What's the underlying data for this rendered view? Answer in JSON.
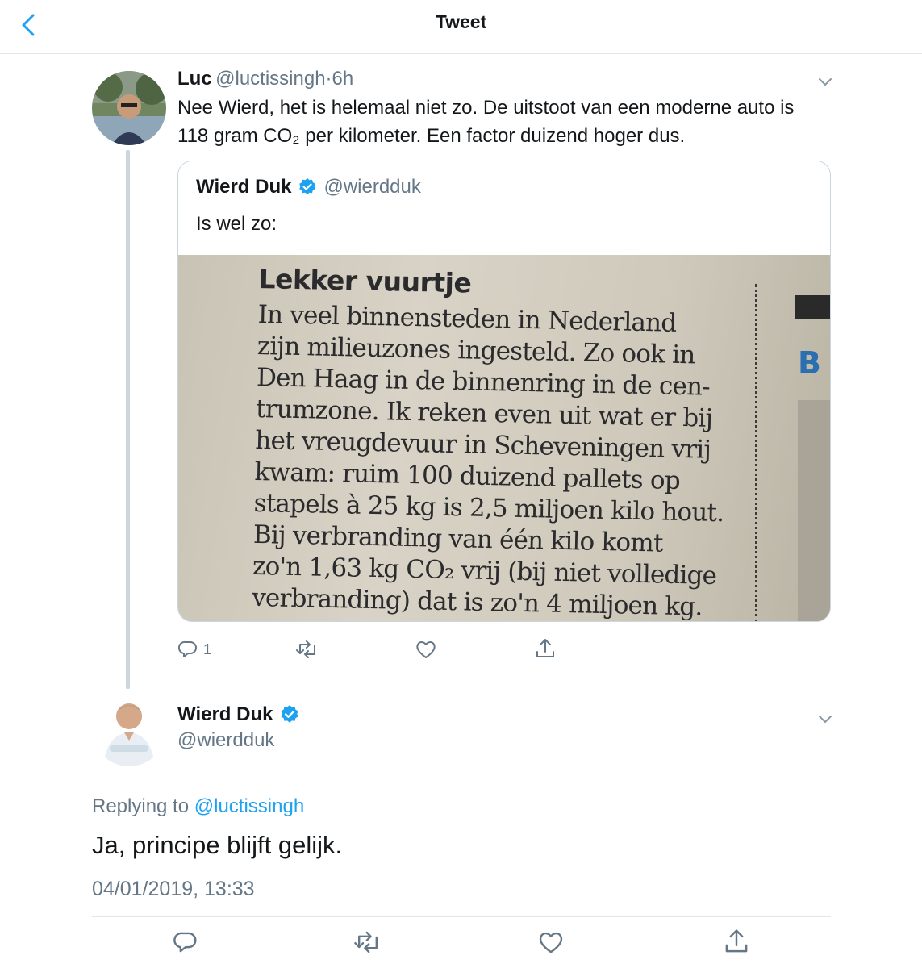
{
  "header": {
    "title": "Tweet",
    "back_icon": "chevron-left-icon"
  },
  "reply_tweet": {
    "author_name": "Luc",
    "author_handle": "@luctissingh",
    "separator": "·",
    "time": "6h",
    "text_line1": "Nee Wierd, het is helemaal niet zo. De uitstoot van een moderne auto is",
    "text_line2": "118 gram CO₂ per kilometer. Een factor duizend hoger dus.",
    "actions": {
      "reply_count": "1"
    }
  },
  "quoted_tweet": {
    "author_name": "Wierd Duk",
    "author_handle": "@wierdduk",
    "text": "Is wel zo:",
    "image": {
      "heading": "Lekker vuurtje",
      "lines": [
        "In veel binnensteden in Nederland",
        "zijn milieuzones ingesteld. Zo ook in",
        "Den Haag in de binnenring in de cen-",
        "trumzone. Ik reken even uit wat er bij",
        "het vreugdevuur in Scheveningen vrij",
        "kwam: ruim 100 duizend pallets op",
        "stapels à 25 kg is 2,5 miljoen kilo hout.",
        "Bij verbranding van één kilo komt",
        "zo'n 1,63 kg CO₂ vrij (bij niet volledige",
        "verbranding) dat is zo'n 4 miljoen kg."
      ],
      "side_text": "B"
    }
  },
  "main_tweet": {
    "author_name": "Wierd Duk",
    "author_handle": "@wierdduk",
    "replying_prefix": "Replying to",
    "replying_to": "@luctissingh",
    "text": "Ja, principe blijft gelijk.",
    "timestamp": "04/01/2019, 13:33"
  },
  "colors": {
    "accent": "#1da1f2",
    "muted": "#657786",
    "border": "#e1e8ed",
    "text": "#14171a"
  }
}
